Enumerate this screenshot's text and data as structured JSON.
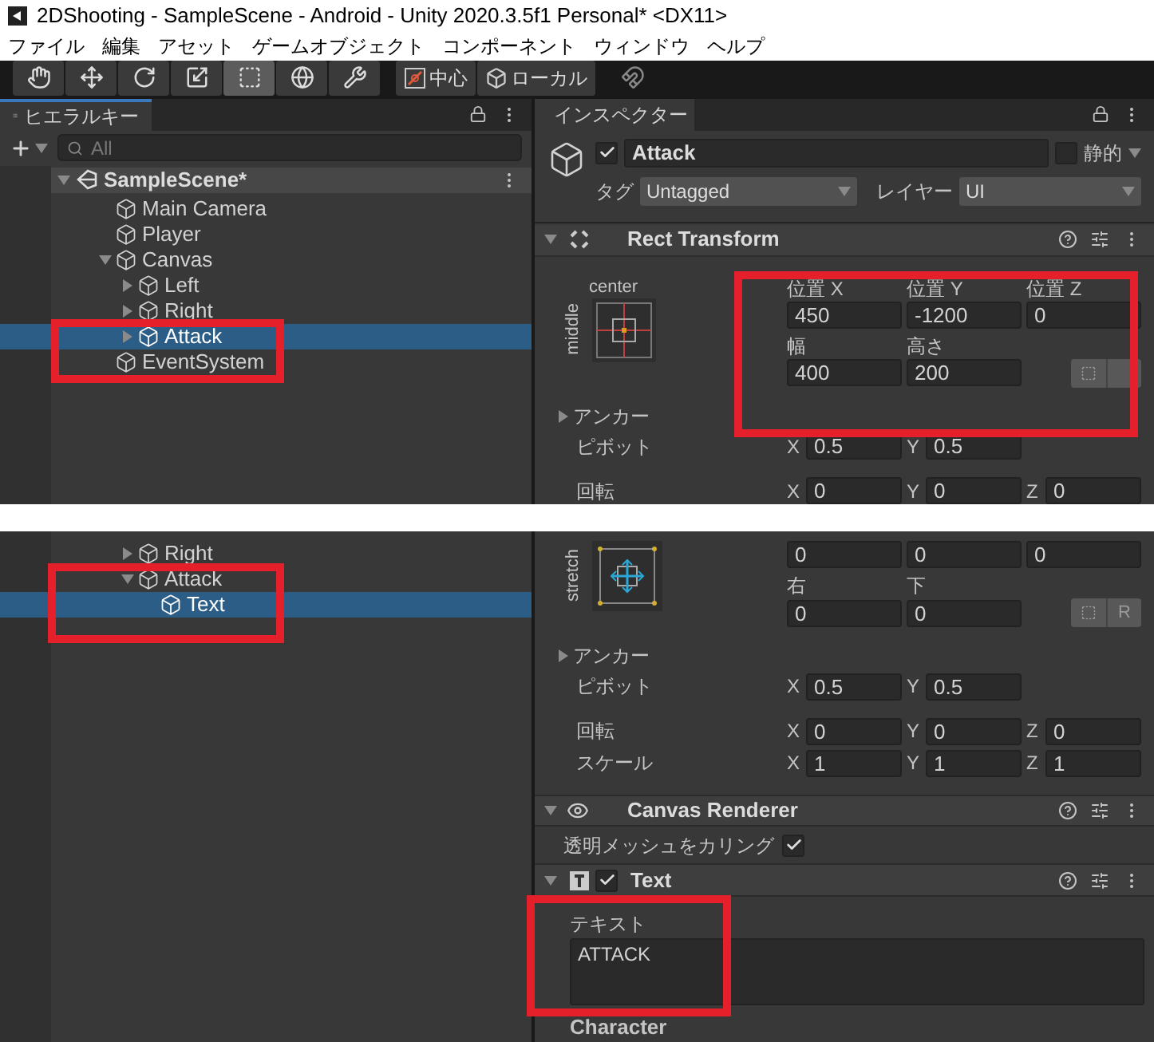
{
  "window": {
    "title": "2DShooting - SampleScene - Android - Unity 2020.3.5f1 Personal* <DX11>"
  },
  "menu": [
    "ファイル",
    "編集",
    "アセット",
    "ゲームオブジェクト",
    "コンポーネント",
    "ウィンドウ",
    "ヘルプ"
  ],
  "toolbar": {
    "tools": [
      {
        "kind": "hand",
        "selected": false
      },
      {
        "kind": "move",
        "selected": false
      },
      {
        "kind": "rotate",
        "selected": false
      },
      {
        "kind": "scale",
        "selected": false
      },
      {
        "kind": "rect",
        "selected": true
      },
      {
        "kind": "transform",
        "selected": false
      },
      {
        "kind": "custom",
        "selected": false
      }
    ],
    "handles": [
      {
        "kind": "pivot",
        "label": "中心"
      },
      {
        "kind": "space",
        "label": "ローカル"
      }
    ]
  },
  "top_capture": {
    "hierarchy": {
      "tab": "ヒエラルキー",
      "search": {
        "placeholder": "All"
      },
      "scene": "SampleScene*",
      "items": [
        {
          "name": "Main Camera",
          "selected": false
        },
        {
          "name": "Player",
          "selected": false
        },
        {
          "name": "Canvas",
          "selected": false,
          "expanded": true,
          "children": [
            {
              "name": "Left",
              "selected": false,
              "expanded": false
            },
            {
              "name": "Right",
              "selected": false,
              "expanded": false
            },
            {
              "name": "Attack",
              "selected": true,
              "expanded": false
            }
          ]
        },
        {
          "name": "EventSystem",
          "selected": false
        }
      ]
    },
    "inspector": {
      "tab": "インスペクター",
      "object": {
        "active": true,
        "name": "Attack",
        "static_label": "静的",
        "static": false,
        "tag_label": "タグ",
        "tag": "Untagged",
        "layer_label": "レイヤー",
        "layer": "UI"
      },
      "rect_transform": {
        "title": "Rect Transform",
        "anchor_horizontal": "center",
        "anchor_vertical": "middle",
        "field_rows": [
          {
            "labels": [
              "位置 X",
              "位置 Y",
              "位置 Z"
            ],
            "values": [
              "450",
              "-1200",
              "0"
            ]
          },
          {
            "labels": [
              "幅",
              "高さ"
            ],
            "values": [
              "400",
              "200"
            ],
            "blueprint_buttons": true
          }
        ],
        "anchors_label": "アンカー",
        "vectors": [
          {
            "label": "ピボット",
            "axes": [
              {
                "axis": "X",
                "value": "0.5"
              },
              {
                "axis": "Y",
                "value": "0.5"
              }
            ]
          },
          {
            "label": "回転",
            "axes": [
              {
                "axis": "X",
                "value": "0"
              },
              {
                "axis": "Y",
                "value": "0"
              },
              {
                "axis": "Z",
                "value": "0"
              }
            ]
          }
        ]
      }
    }
  },
  "bottom_capture": {
    "hierarchy": {
      "items": [
        {
          "name": "Right",
          "selected": false,
          "expanded": false
        },
        {
          "name": "Attack",
          "selected": false,
          "expanded": true,
          "children": [
            {
              "name": "Text",
              "selected": true
            }
          ]
        }
      ]
    },
    "inspector": {
      "rect_transform": {
        "anchor_vertical": "stretch",
        "field_rows": [
          {
            "values": [
              "0",
              "0",
              "0"
            ]
          },
          {
            "labels": [
              "右",
              "下"
            ],
            "values": [
              "0",
              "0"
            ],
            "blueprint_buttons": true,
            "raw_label": "R"
          }
        ],
        "anchors_label": "アンカー",
        "vectors": [
          {
            "label": "ピボット",
            "axes": [
              {
                "axis": "X",
                "value": "0.5"
              },
              {
                "axis": "Y",
                "value": "0.5"
              }
            ]
          },
          {
            "label": "回転",
            "axes": [
              {
                "axis": "X",
                "value": "0"
              },
              {
                "axis": "Y",
                "value": "0"
              },
              {
                "axis": "Z",
                "value": "0"
              }
            ]
          },
          {
            "label": "スケール",
            "axes": [
              {
                "axis": "X",
                "value": "1"
              },
              {
                "axis": "Y",
                "value": "1"
              },
              {
                "axis": "Z",
                "value": "1"
              }
            ]
          }
        ]
      },
      "canvas_renderer": {
        "title": "Canvas Renderer",
        "option": {
          "label": "透明メッシュをカリング",
          "checked": true
        }
      },
      "text_component": {
        "title": "Text",
        "enabled": true,
        "field_label": "テキスト",
        "value": "ATTACK",
        "section": "Character"
      }
    }
  }
}
